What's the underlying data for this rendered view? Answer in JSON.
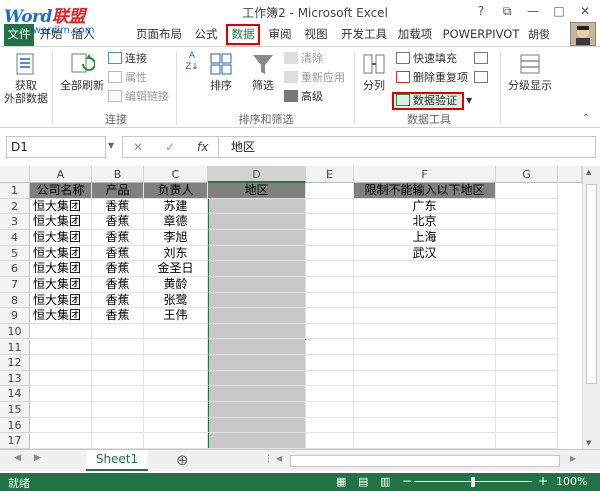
{
  "watermark": {
    "brand_a": "Word",
    "brand_b": "联盟",
    "site": "www.wordlm.com"
  },
  "window": {
    "title": "工作簿2 - Microsoft Excel",
    "help": "?",
    "restore_ribbon": "⧉",
    "minimize": "—",
    "maximize": "□",
    "close": "✕"
  },
  "tabs": [
    "文件",
    "开始",
    "插入",
    "页面布局",
    "公式",
    "数据",
    "审阅",
    "视图",
    "开发工具",
    "加载项",
    "POWERPIVOT"
  ],
  "active_tab": "数据",
  "user": "胡俊",
  "ribbon": {
    "get_external_data": "获取\n外部数据",
    "refresh_all": "全部刷新",
    "connections": "连接",
    "properties": "属性",
    "edit_links": "编辑链接",
    "group_connections": "连接",
    "sort": "排序",
    "filter": "筛选",
    "clear": "清除",
    "reapply": "重新应用",
    "advanced": "高级",
    "group_sort_filter": "排序和筛选",
    "text_to_columns": "分列",
    "flash_fill": "快速填充",
    "remove_duplicates": "删除重复项",
    "data_validation": "数据验证",
    "group_data_tools": "数据工具",
    "outline": "分级显示"
  },
  "formula_bar": {
    "name_box": "D1",
    "fx": "fx",
    "value": "地区"
  },
  "columns": [
    "A",
    "B",
    "C",
    "D",
    "E",
    "F",
    "G"
  ],
  "rows": [
    "1",
    "2",
    "3",
    "4",
    "5",
    "6",
    "7",
    "8",
    "9",
    "10",
    "11",
    "12",
    "13",
    "14",
    "15",
    "16",
    "17"
  ],
  "cells": {
    "A": [
      "公司名称",
      "恒大集团",
      "恒大集团",
      "恒大集团",
      "恒大集团",
      "恒大集团",
      "恒大集团",
      "恒大集团",
      "恒大集团"
    ],
    "B": [
      "产品",
      "香蕉",
      "香蕉",
      "香蕉",
      "香蕉",
      "香蕉",
      "香蕉",
      "香蕉",
      "香蕉"
    ],
    "C": [
      "负责人",
      "苏建",
      "章德",
      "李旭",
      "刘东",
      "金圣日",
      "黄龄",
      "张鹭",
      "王伟"
    ],
    "D": [
      "地区"
    ],
    "F": [
      "限制不能输入以下地区",
      "广东",
      "北京",
      "上海",
      "武汉"
    ]
  },
  "sheet_tab": "Sheet1",
  "status": {
    "ready": "就绪",
    "zoom": "100%"
  },
  "colors": {
    "accent": "#217346",
    "highlight": "#e00000",
    "header_fill": "#808080"
  }
}
